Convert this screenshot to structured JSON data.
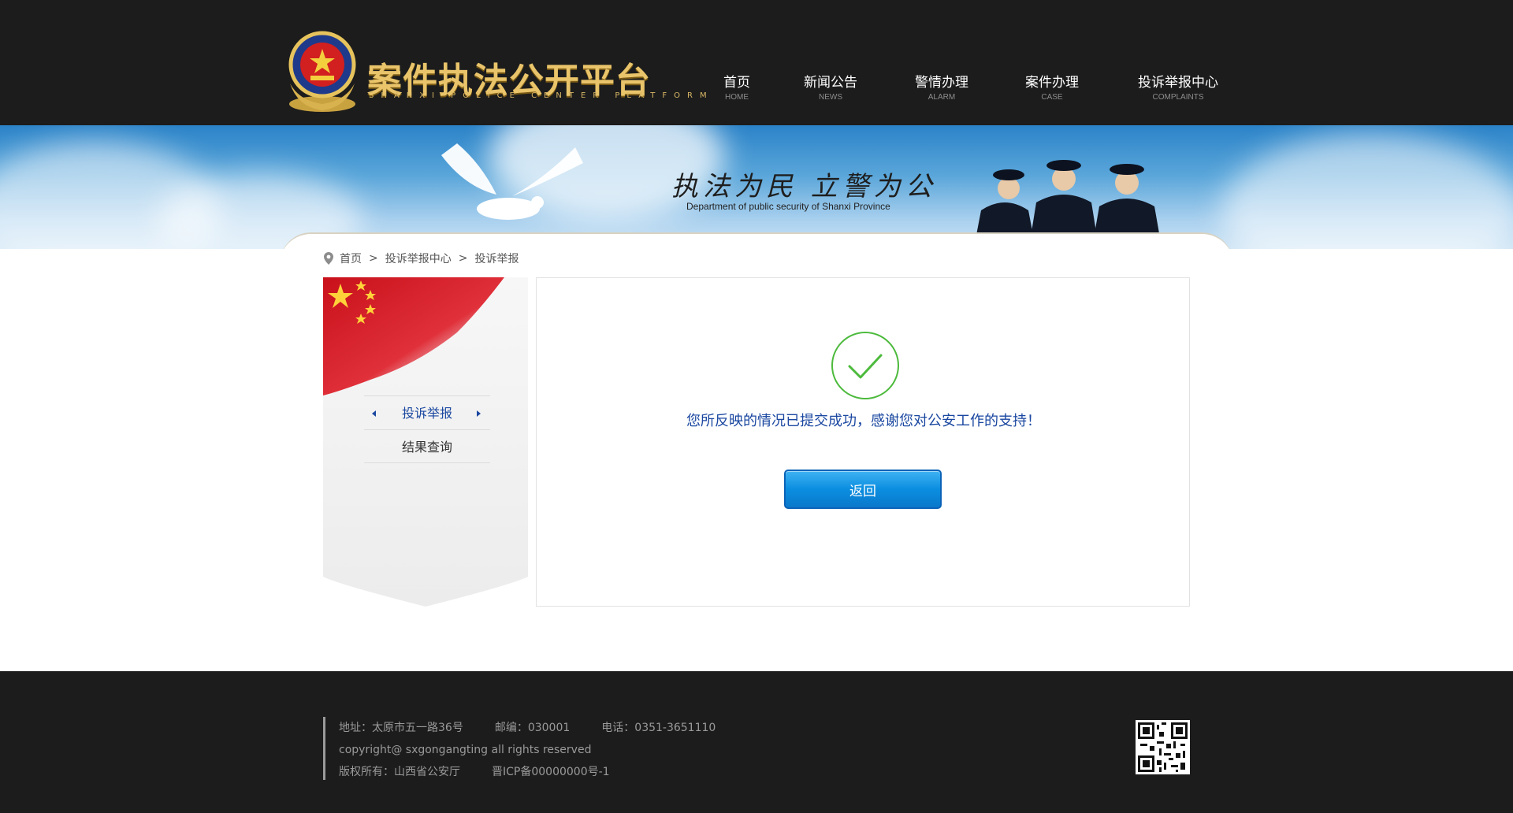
{
  "header": {
    "logo_title": "案件执法公开平台",
    "logo_subtitle": "SHANXI POLICE CENTER PLATFORM",
    "nav": [
      {
        "cn": "首页",
        "en": "HOME"
      },
      {
        "cn": "新闻公告",
        "en": "NEWS"
      },
      {
        "cn": "警情办理",
        "en": "ALARM"
      },
      {
        "cn": "案件办理",
        "en": "CASE"
      },
      {
        "cn": "投诉举报中心",
        "en": "COMPLAINTS"
      }
    ]
  },
  "banner": {
    "slogan": "执法为民  立警为公",
    "english": "Department of public security of Shanxi Province"
  },
  "breadcrumb": {
    "items": [
      "首页",
      "投诉举报中心",
      "投诉举报"
    ],
    "separator": ">"
  },
  "sidebar": {
    "items": [
      {
        "label": "投诉举报",
        "active": true
      },
      {
        "label": "结果查询",
        "active": false
      }
    ]
  },
  "result": {
    "message": "您所反映的情况已提交成功，感谢您对公安工作的支持！",
    "back_label": "返回"
  },
  "footer": {
    "address": "地址：太原市五一路36号",
    "postcode": "邮编：030001",
    "phone": "电话：0351-3651110",
    "copyright": "copyright@ sxgongangting all rights reserved",
    "owner": "版权所有：山西省公安厅",
    "icp": "晋ICP备00000000号-1"
  },
  "colors": {
    "header_bg": "#1c1c1c",
    "accent_blue": "#1a47a0",
    "button_blue": "#0b8ee0",
    "success_green": "#4cba3c",
    "logo_gold": "#e9c46a"
  },
  "icons": [
    "police-emblem-icon",
    "location-pin-icon",
    "check-circle-icon",
    "qr-code-icon"
  ]
}
